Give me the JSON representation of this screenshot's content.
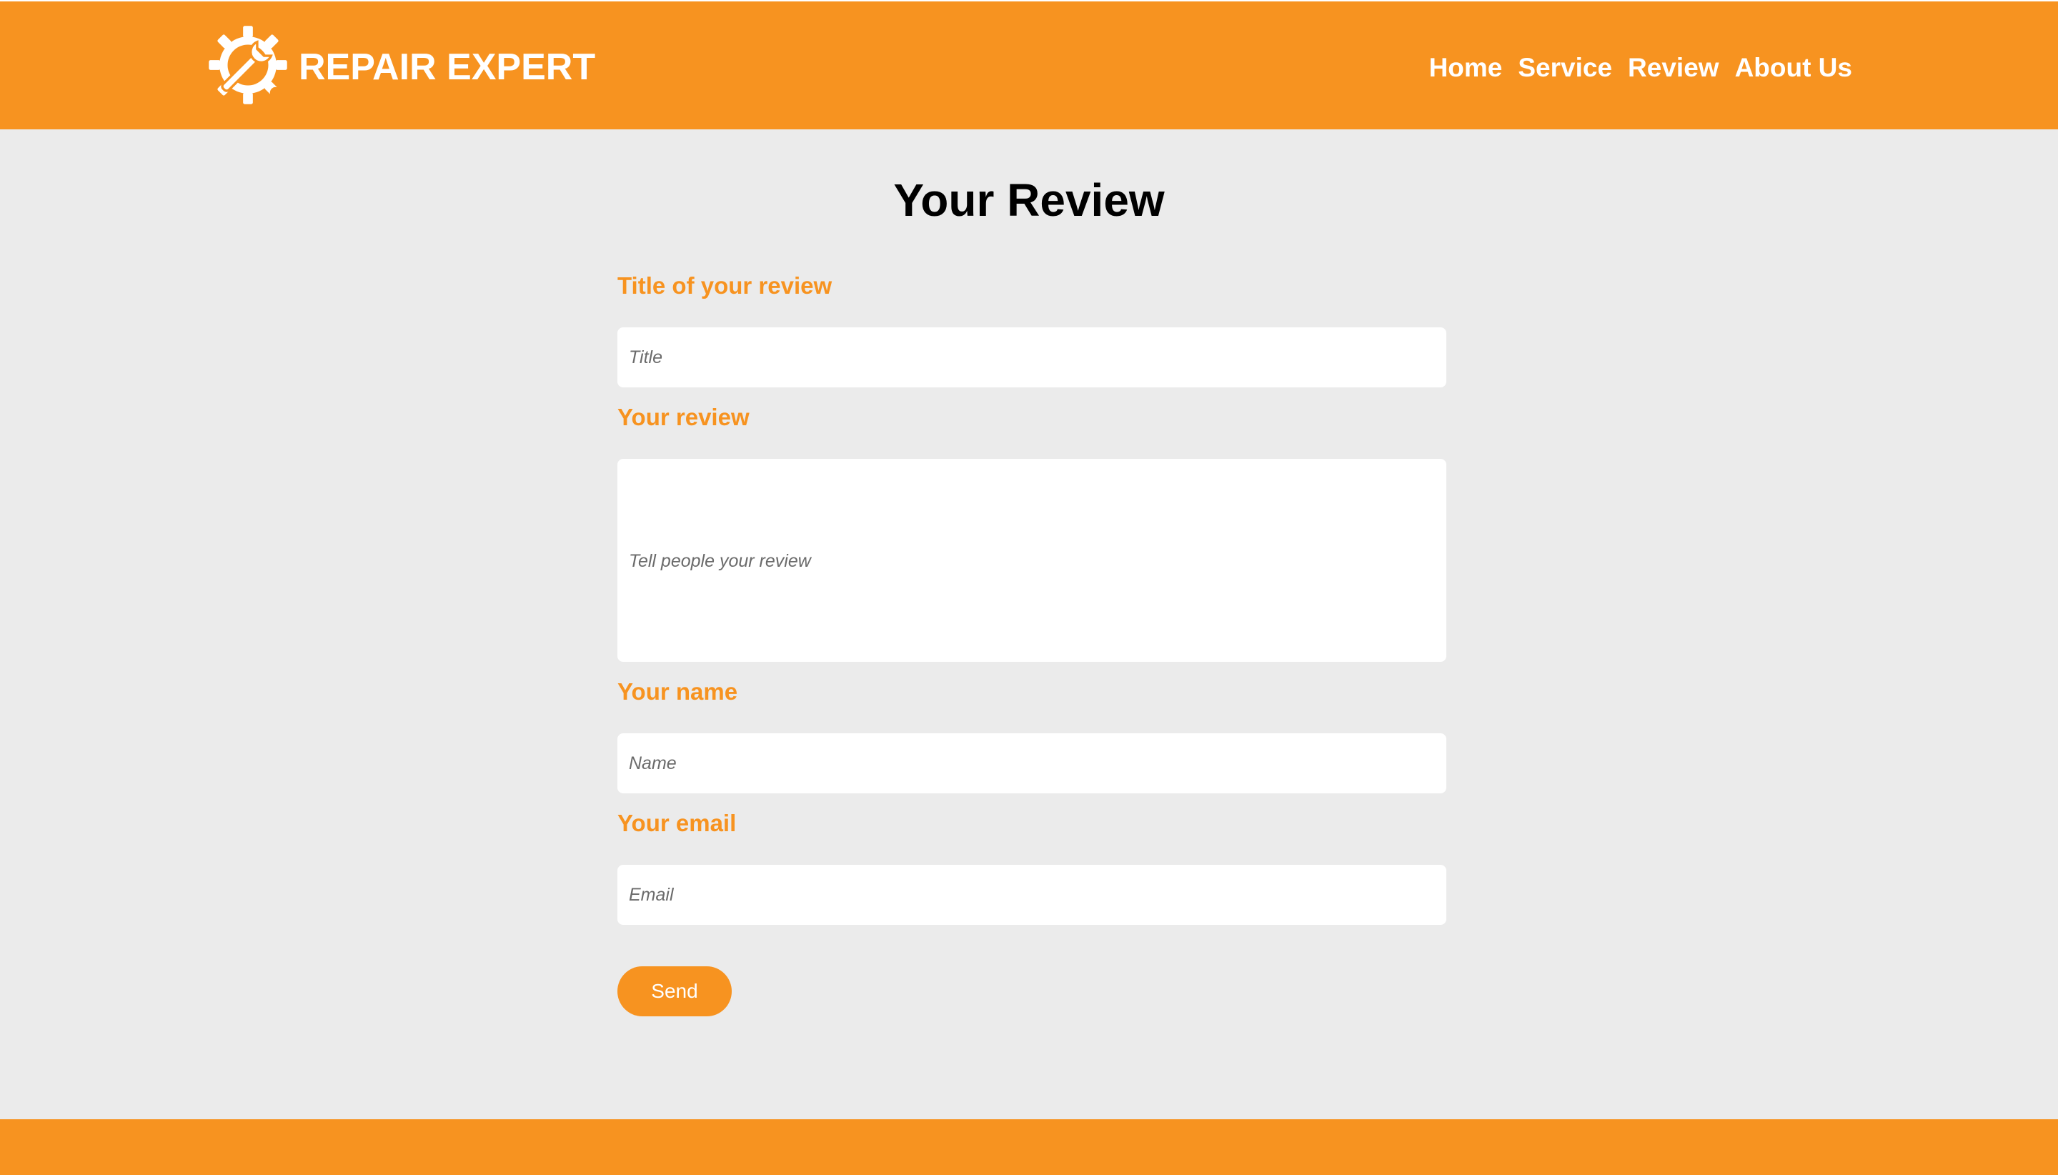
{
  "brand": {
    "name": "REPAIR EXPERT",
    "logo_icon": "gear-wrench-icon"
  },
  "nav": {
    "items": [
      {
        "label": "Home"
      },
      {
        "label": "Service"
      },
      {
        "label": "Review"
      },
      {
        "label": "About Us"
      }
    ]
  },
  "page": {
    "title": "Your Review"
  },
  "form": {
    "title_label": "Title of your review",
    "title_placeholder": "Title",
    "title_value": "",
    "review_label": "Your review",
    "review_placeholder": "Tell people your review",
    "review_value": "",
    "name_label": "Your name",
    "name_placeholder": "Name",
    "name_value": "",
    "email_label": "Your email",
    "email_placeholder": "Email",
    "email_value": "",
    "send_label": "Send"
  },
  "colors": {
    "accent": "#f79320",
    "background": "#ebebeb",
    "field_background": "#ffffff",
    "title_text": "#000000",
    "header_text": "#ffffff"
  }
}
